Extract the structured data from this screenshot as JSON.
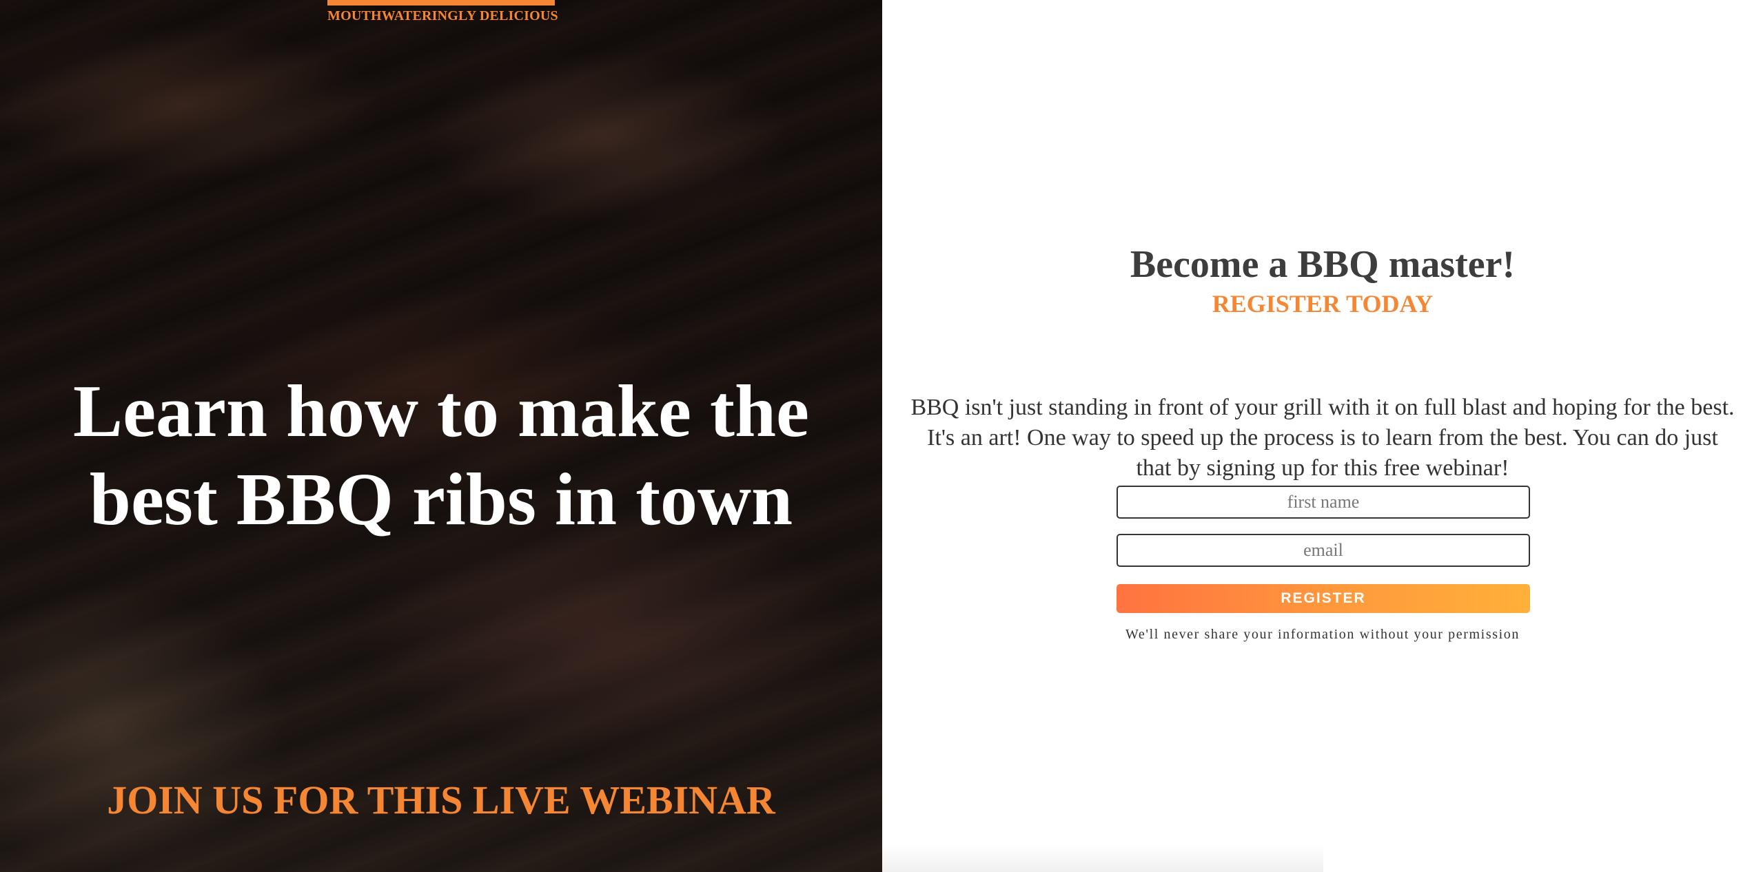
{
  "hero": {
    "brand_tag": "MOUTHWATERINGLY DELICIOUS",
    "headline_part1": "Learn how to make ",
    "headline_bold1": "the best BBQ ribs",
    "headline_part2": " in town",
    "cta": "JOIN US FOR THIS LIVE WEBINAR"
  },
  "form": {
    "title": "Become a BBQ master!",
    "subtitle": "REGISTER TODAY",
    "description": "BBQ isn't just standing in front of your grill with it on full blast and hoping for the best. It's an art! One way to speed up the process is to learn from the best. You can do just that by signing up for this free webinar!",
    "first_name_placeholder": "first name",
    "email_placeholder": "email",
    "register_label": "REGISTER",
    "privacy_note": "We'll never share your information without your permission"
  },
  "colors": {
    "accent": "#f58634",
    "button_gradient_start": "#ff7340",
    "button_gradient_end": "#ffb03a",
    "heading_text": "#3d3d3d"
  }
}
